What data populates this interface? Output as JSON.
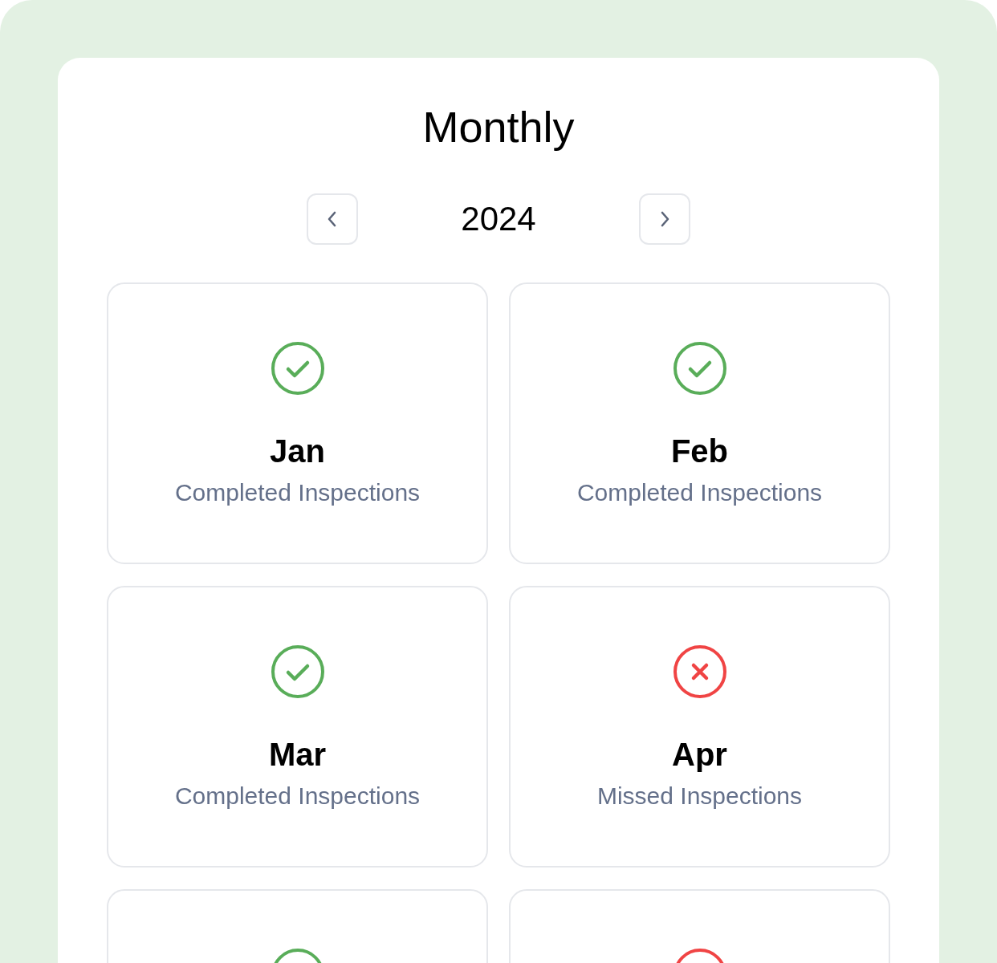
{
  "title": "Monthly",
  "year_nav": {
    "year": "2024"
  },
  "months": [
    {
      "month": "Jan",
      "caption": "Completed Inspections",
      "completed": true
    },
    {
      "month": "Feb",
      "caption": "Completed Inspections",
      "completed": true
    },
    {
      "month": "Mar",
      "caption": "Completed Inspections",
      "completed": true
    },
    {
      "month": "Apr",
      "caption": "Missed Inspections",
      "completed": false
    },
    {
      "completed": true
    },
    {
      "completed": false
    }
  ]
}
